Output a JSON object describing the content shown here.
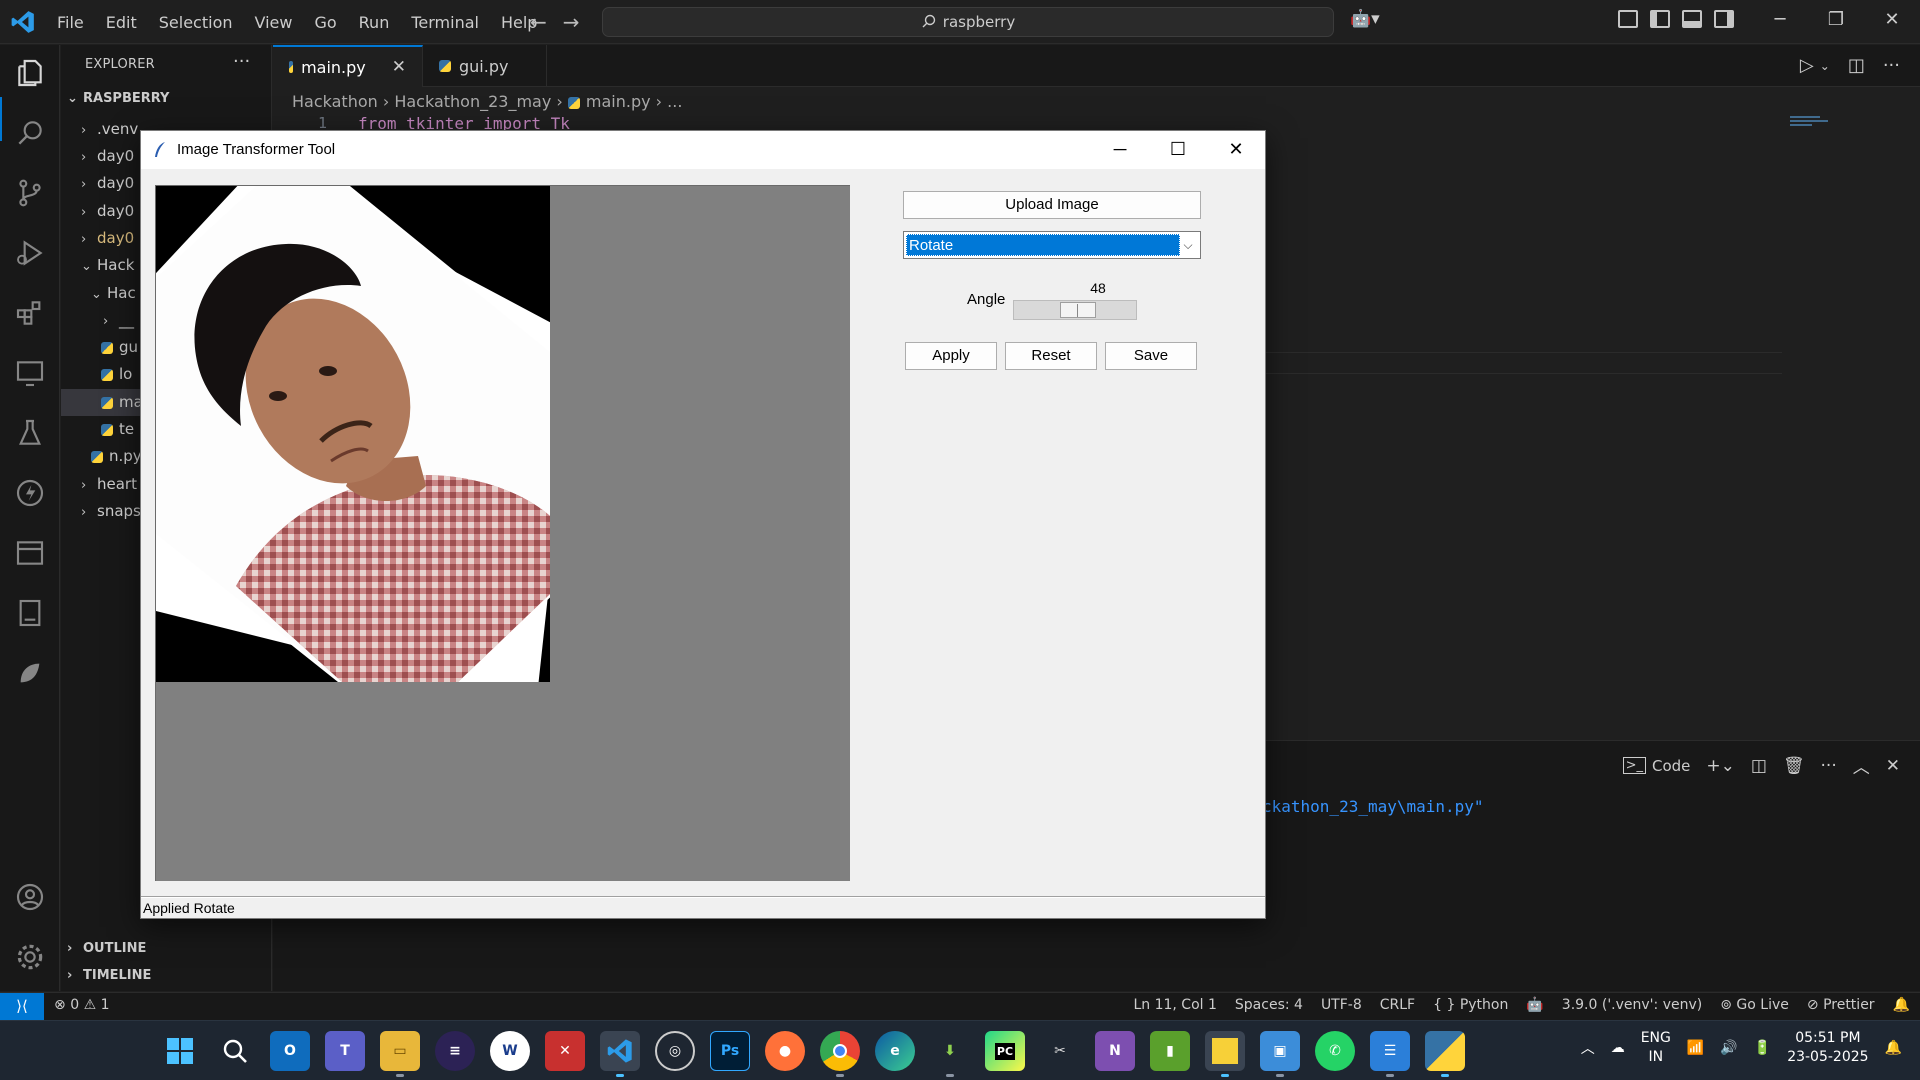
{
  "titlebar": {
    "menu": [
      "File",
      "Edit",
      "Selection",
      "View",
      "Go",
      "Run",
      "Terminal",
      "Help"
    ],
    "search_text": "raspberry"
  },
  "explorer": {
    "title": "EXPLORER",
    "root": "RASPBERRY",
    "items": [
      {
        "label": ".venv"
      },
      {
        "label": "day0"
      },
      {
        "label": "day0"
      },
      {
        "label": "day0"
      },
      {
        "label": "day0"
      },
      {
        "label": "Hack"
      },
      {
        "label": "Hac"
      },
      {
        "label": "__"
      },
      {
        "label": "gu"
      },
      {
        "label": "lo"
      },
      {
        "label": "ma"
      },
      {
        "label": "te"
      },
      {
        "label": "n.py"
      },
      {
        "label": "heart"
      },
      {
        "label": "snaps"
      }
    ],
    "outline": "OUTLINE",
    "timeline": "TIMELINE"
  },
  "tabs": [
    {
      "label": "main.py"
    },
    {
      "label": "gui.py"
    }
  ],
  "breadcrumb": [
    "Hackathon",
    "Hackathon_23_may",
    "main.py",
    "..."
  ],
  "editor": {
    "line_number": "1",
    "code": "from tkinter import Tk"
  },
  "panel": {
    "terminal_name": "Code",
    "terminal_text": "ckathon_23_may\\main.py\""
  },
  "statusbar": {
    "errors": "0",
    "warnings": "1",
    "position": "Ln 11, Col 1",
    "spaces": "Spaces: 4",
    "encoding": "UTF-8",
    "eol": "CRLF",
    "language": "Python",
    "interpreter": "3.9.0 ('.venv': venv)",
    "golive": "Go Live",
    "prettier": "Prettier"
  },
  "taskbar": {
    "lang_line1": "ENG",
    "lang_line2": "IN",
    "time": "05:51 PM",
    "date": "23-05-2025"
  },
  "tk_window": {
    "title": "Image Transformer Tool",
    "upload_label": "Upload Image",
    "operation": "Rotate",
    "angle_label": "Angle",
    "angle_value": "48",
    "angle_fraction": 0.53,
    "apply_label": "Apply",
    "reset_label": "Reset",
    "save_label": "Save",
    "status": "Applied Rotate"
  },
  "colors": {
    "accent": "#0078d4",
    "combo_selection": "#0078d7",
    "canvas_bg": "#808080"
  }
}
